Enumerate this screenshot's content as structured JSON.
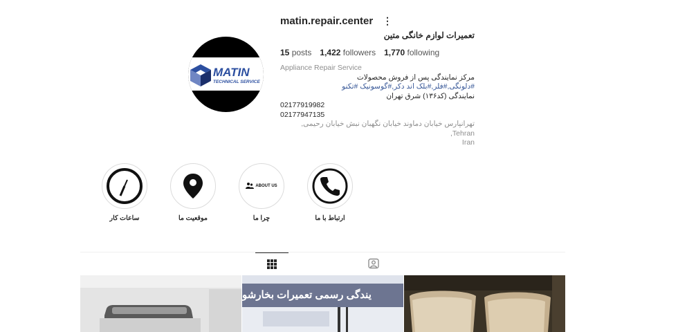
{
  "profile": {
    "username": "matin.repair.center",
    "more_glyph": "⋮",
    "full_name": "تعمیرات لوازم خانگی متین",
    "avatar_brand": "MATIN",
    "avatar_sub": "TECHNICAL SERVICE"
  },
  "stats": {
    "posts_count": "15",
    "posts_label": "posts",
    "followers_count": "1,422",
    "followers_label": "followers",
    "following_count": "1,770",
    "following_label": "following"
  },
  "bio": {
    "category": "Appliance Repair Service",
    "line1": "مرکز نمایندگی پس از فروش محصولات",
    "tags": "#دلونگی,#فلر,#بلک اند دکر,#گوسونیک #تکنو",
    "line3": "نمایندگی (کد۱۳۶) شرق تهران",
    "phone1": "02177919982",
    "phone2": "02177947135",
    "location_line1": "تهرانپارس خیابان دماوند خیابان نگهبان نبش خیابان رحیمی, Tehran,",
    "location_line2": "Iran"
  },
  "highlights": [
    {
      "label": "ساعات کار",
      "icon": "clock-icon"
    },
    {
      "label": "موقعیت ما",
      "icon": "location-pin-icon"
    },
    {
      "label": "چرا ما",
      "icon": "about-us-icon",
      "icon_text": "ABOUT US"
    },
    {
      "label": "ارتباط با ما",
      "icon": "phone-icon"
    }
  ],
  "tabs": [
    {
      "name": "posts",
      "icon": "grid-icon",
      "active": true
    },
    {
      "name": "tagged",
      "icon": "tagged-icon",
      "active": false
    }
  ],
  "posts": [
    {
      "alt": "appliance-photo"
    },
    {
      "text": "یندگی رسمی تعمیرات بخارشو"
    },
    {
      "alt": "blender-jars-photo"
    }
  ]
}
